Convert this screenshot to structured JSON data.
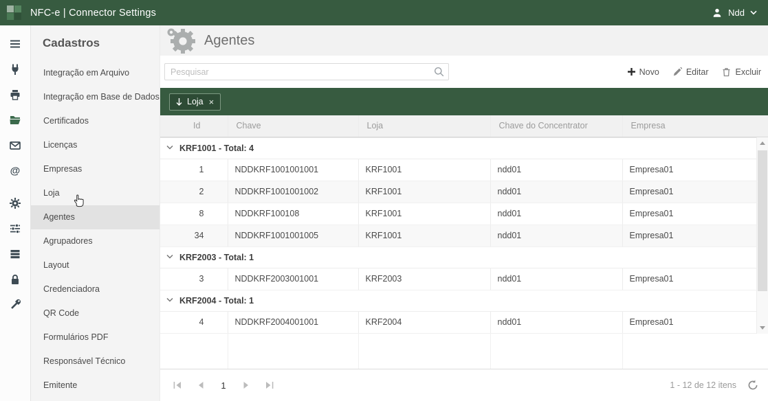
{
  "topbar": {
    "title": "NFC-e | Connector Settings",
    "user": "Ndd"
  },
  "rail_icons": [
    "menu",
    "plug",
    "printer",
    "folder-open",
    "envelope",
    "at-sign",
    "gear",
    "sliders",
    "rows",
    "lock",
    "wrench"
  ],
  "sidebar": {
    "title": "Cadastros",
    "selected": "Agentes",
    "items": [
      "Integração em Arquivo",
      "Integração em Base de Dados",
      "Certificados",
      "Licenças",
      "Empresas",
      "Loja",
      "Agentes",
      "Agrupadores",
      "Layout",
      "Credenciadora",
      "QR Code",
      "Formulários PDF",
      "Responsável Técnico",
      "Emitente"
    ]
  },
  "main": {
    "page_title": "Agentes",
    "search": {
      "placeholder": "Pesquisar"
    },
    "toolbar": {
      "new_label": "Novo",
      "edit_label": "Editar",
      "delete_label": "Excluir"
    },
    "group_bar": {
      "chip_label": "Loja",
      "remove_symbol": "×"
    },
    "table": {
      "columns": [
        "Id",
        "Chave",
        "Loja",
        "Chave do Concentrator",
        "Empresa"
      ],
      "groups": [
        {
          "header": "KRF1001 - Total: 4",
          "rows": [
            [
              "1",
              "NDDKRF1001001001",
              "KRF1001",
              "ndd01",
              "Empresa01"
            ],
            [
              "2",
              "NDDKRF1001001002",
              "KRF1001",
              "ndd01",
              "Empresa01"
            ],
            [
              "8",
              "NDDKRF100108",
              "KRF1001",
              "ndd01",
              "Empresa01"
            ],
            [
              "34",
              "NDDKRF1001001005",
              "KRF1001",
              "ndd01",
              "Empresa01"
            ]
          ]
        },
        {
          "header": "KRF2003 - Total: 1",
          "rows": [
            [
              "3",
              "NDDKRF2003001001",
              "KRF2003",
              "ndd01",
              "Empresa01"
            ]
          ]
        },
        {
          "header": "KRF2004 - Total: 1",
          "rows": [
            [
              "4",
              "NDDKRF2004001001",
              "KRF2004",
              "ndd01",
              "Empresa01"
            ]
          ]
        }
      ]
    },
    "pager": {
      "page": "1",
      "summary": "1 - 12 de 12 itens"
    },
    "colors": {
      "header_green": "#375b40",
      "chip_green": "#2d4b35",
      "selected_gray": "#e2e2e2"
    }
  }
}
